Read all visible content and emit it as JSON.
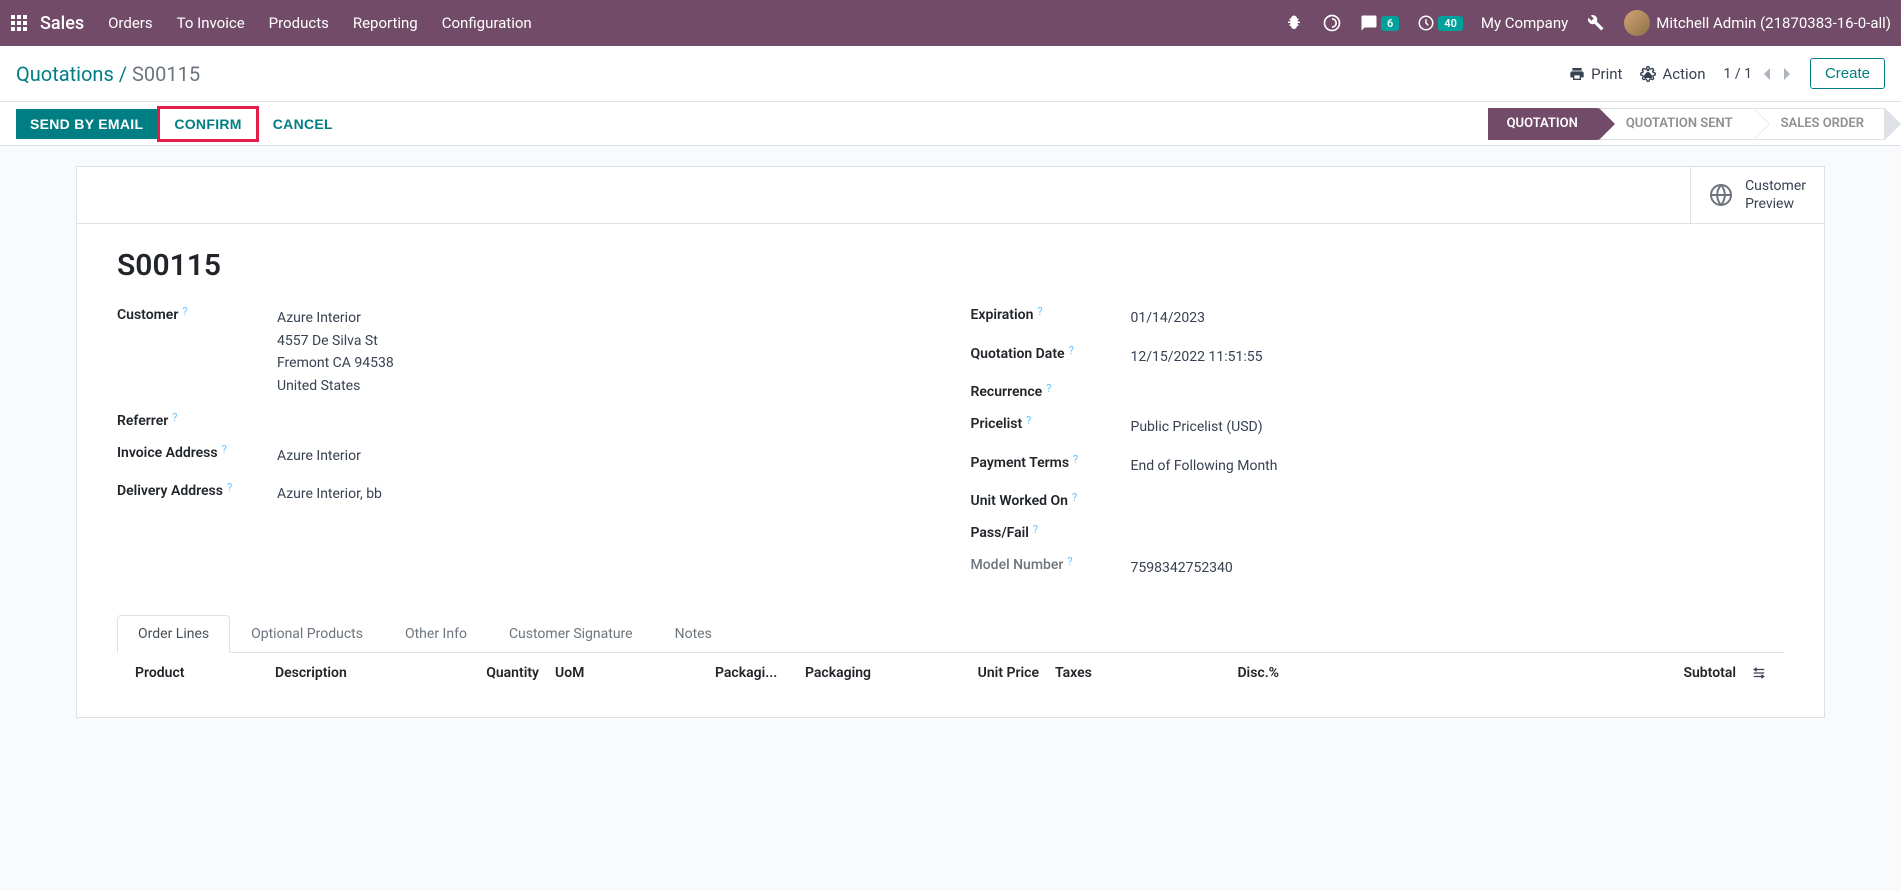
{
  "topbar": {
    "brand": "Sales",
    "nav": [
      "Orders",
      "To Invoice",
      "Products",
      "Reporting",
      "Configuration"
    ],
    "msg_count": "6",
    "activity_count": "40",
    "company": "My Company",
    "user": "Mitchell Admin (21870383-16-0-all)"
  },
  "subbar": {
    "breadcrumb_root": "Quotations",
    "breadcrumb_current": "S00115",
    "print": "Print",
    "action": "Action",
    "pager": "1 / 1",
    "create": "Create"
  },
  "actions": {
    "send_email": "SEND BY EMAIL",
    "confirm": "CONFIRM",
    "cancel": "CANCEL"
  },
  "status": {
    "quotation": "QUOTATION",
    "quotation_sent": "QUOTATION SENT",
    "sales_order": "SALES ORDER"
  },
  "button_box": {
    "customer_preview_l1": "Customer",
    "customer_preview_l2": "Preview"
  },
  "record": {
    "title": "S00115",
    "left": {
      "customer_label": "Customer",
      "customer_name": "Azure Interior",
      "customer_addr1": "4557 De Silva St",
      "customer_addr2": "Fremont CA 94538",
      "customer_addr3": "United States",
      "referrer_label": "Referrer",
      "invoice_addr_label": "Invoice Address",
      "invoice_addr": "Azure Interior",
      "delivery_addr_label": "Delivery Address",
      "delivery_addr": "Azure Interior, bb"
    },
    "right": {
      "expiration_label": "Expiration",
      "expiration": "01/14/2023",
      "quotation_date_label": "Quotation Date",
      "quotation_date": "12/15/2022 11:51:55",
      "recurrence_label": "Recurrence",
      "pricelist_label": "Pricelist",
      "pricelist": "Public Pricelist (USD)",
      "payment_terms_label": "Payment Terms",
      "payment_terms": "End of Following Month",
      "unit_worked_label": "Unit Worked On",
      "passfail_label": "Pass/Fail",
      "model_number_label": "Model Number",
      "model_number": "7598342752340"
    }
  },
  "tabs": [
    "Order Lines",
    "Optional Products",
    "Other Info",
    "Customer Signature",
    "Notes"
  ],
  "table_headers": {
    "product": "Product",
    "description": "Description",
    "quantity": "Quantity",
    "uom": "UoM",
    "packagi": "Packagi...",
    "packaging": "Packaging",
    "unit_price": "Unit Price",
    "taxes": "Taxes",
    "disc": "Disc.%",
    "subtotal": "Subtotal"
  },
  "help": "?"
}
